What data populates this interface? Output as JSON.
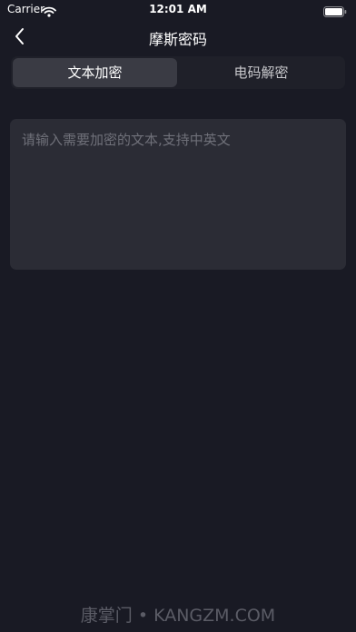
{
  "status_bar": {
    "carrier": "Carrier",
    "time": "12:01 AM",
    "wifi_icon": "wifi-icon",
    "battery_icon": "battery-icon"
  },
  "nav": {
    "title": "摩斯密码",
    "back_icon": "chevron-left-icon"
  },
  "segments": {
    "encrypt": "文本加密",
    "decrypt": "电码解密",
    "selected": "encrypt"
  },
  "input": {
    "placeholder": "请输入需要加密的文本,支持中英文",
    "value": ""
  },
  "watermark": "康掌门 • KANGZM.COM",
  "colors": {
    "background": "#191a24",
    "input_background": "#2b2c35",
    "segment_active": "#3a3b44",
    "placeholder": "#6f7079"
  }
}
